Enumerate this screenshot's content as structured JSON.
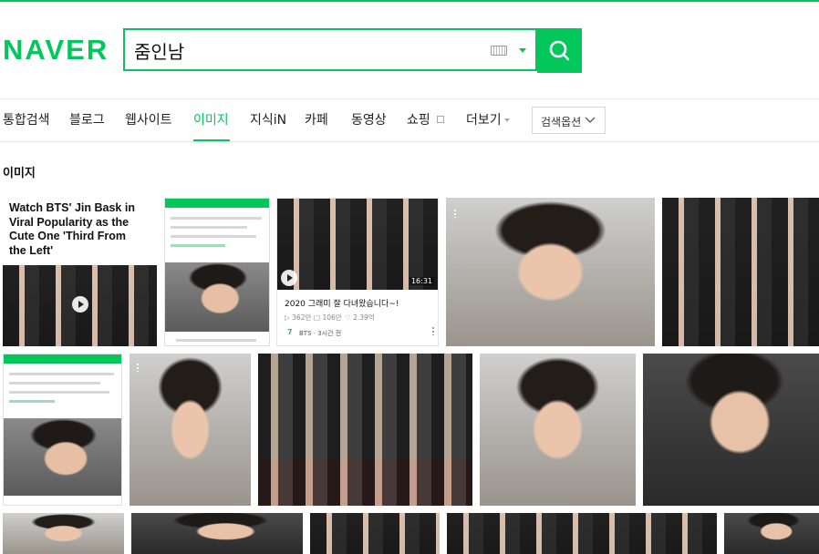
{
  "brand": {
    "logo_text": "NAVER",
    "accent_color": "#03c75a"
  },
  "search": {
    "query": "줌인남",
    "keyboard_icon": "keyboard-icon",
    "search_icon": "magnifier-icon"
  },
  "tabs": [
    {
      "label": "통합검색"
    },
    {
      "label": "블로그"
    },
    {
      "label": "웹사이트"
    },
    {
      "label": "이미지",
      "active": true
    },
    {
      "label": "지식iN"
    },
    {
      "label": "카페"
    },
    {
      "label": "동영상"
    },
    {
      "label": "쇼핑"
    },
    {
      "label": "더보기"
    }
  ],
  "search_options": {
    "label": "검색옵션"
  },
  "section": {
    "title": "이미지"
  },
  "results": {
    "r1": {
      "title": "Watch BTS' Jin Bask in Viral Popularity as the Cute One 'Third From the Left'"
    },
    "r3": {
      "duration": "16:31",
      "caption": "2020 그래미 잘 다녀왔습니다~!",
      "views": "▷ 362만",
      "comments": "□ 106만",
      "likes": "♡ 2.39억",
      "channel_rank": "7",
      "channel": "BTS · 3시간 전"
    }
  }
}
